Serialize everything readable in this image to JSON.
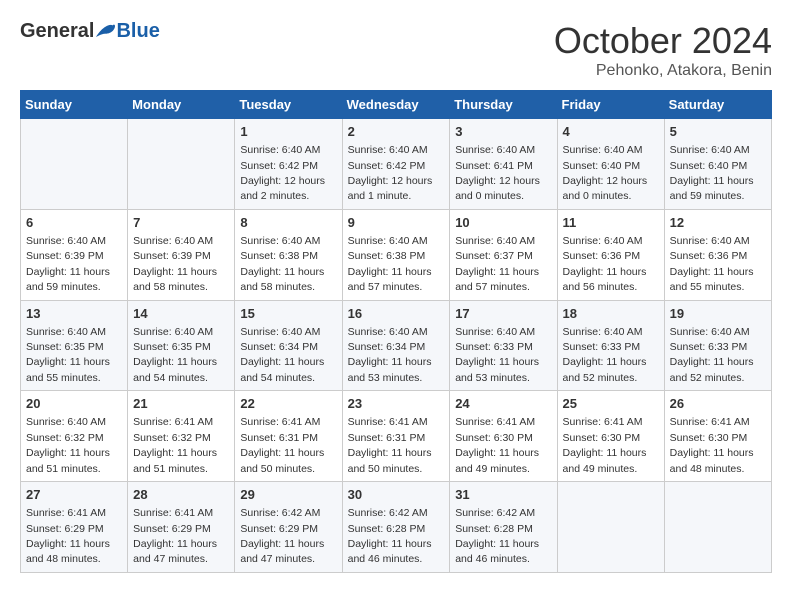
{
  "logo": {
    "general": "General",
    "blue": "Blue"
  },
  "header": {
    "month": "October 2024",
    "location": "Pehonko, Atakora, Benin"
  },
  "days_of_week": [
    "Sunday",
    "Monday",
    "Tuesday",
    "Wednesday",
    "Thursday",
    "Friday",
    "Saturday"
  ],
  "weeks": [
    [
      {
        "day": "",
        "info": ""
      },
      {
        "day": "",
        "info": ""
      },
      {
        "day": "1",
        "info": "Sunrise: 6:40 AM\nSunset: 6:42 PM\nDaylight: 12 hours\nand 2 minutes."
      },
      {
        "day": "2",
        "info": "Sunrise: 6:40 AM\nSunset: 6:42 PM\nDaylight: 12 hours\nand 1 minute."
      },
      {
        "day": "3",
        "info": "Sunrise: 6:40 AM\nSunset: 6:41 PM\nDaylight: 12 hours\nand 0 minutes."
      },
      {
        "day": "4",
        "info": "Sunrise: 6:40 AM\nSunset: 6:40 PM\nDaylight: 12 hours\nand 0 minutes."
      },
      {
        "day": "5",
        "info": "Sunrise: 6:40 AM\nSunset: 6:40 PM\nDaylight: 11 hours\nand 59 minutes."
      }
    ],
    [
      {
        "day": "6",
        "info": "Sunrise: 6:40 AM\nSunset: 6:39 PM\nDaylight: 11 hours\nand 59 minutes."
      },
      {
        "day": "7",
        "info": "Sunrise: 6:40 AM\nSunset: 6:39 PM\nDaylight: 11 hours\nand 58 minutes."
      },
      {
        "day": "8",
        "info": "Sunrise: 6:40 AM\nSunset: 6:38 PM\nDaylight: 11 hours\nand 58 minutes."
      },
      {
        "day": "9",
        "info": "Sunrise: 6:40 AM\nSunset: 6:38 PM\nDaylight: 11 hours\nand 57 minutes."
      },
      {
        "day": "10",
        "info": "Sunrise: 6:40 AM\nSunset: 6:37 PM\nDaylight: 11 hours\nand 57 minutes."
      },
      {
        "day": "11",
        "info": "Sunrise: 6:40 AM\nSunset: 6:36 PM\nDaylight: 11 hours\nand 56 minutes."
      },
      {
        "day": "12",
        "info": "Sunrise: 6:40 AM\nSunset: 6:36 PM\nDaylight: 11 hours\nand 55 minutes."
      }
    ],
    [
      {
        "day": "13",
        "info": "Sunrise: 6:40 AM\nSunset: 6:35 PM\nDaylight: 11 hours\nand 55 minutes."
      },
      {
        "day": "14",
        "info": "Sunrise: 6:40 AM\nSunset: 6:35 PM\nDaylight: 11 hours\nand 54 minutes."
      },
      {
        "day": "15",
        "info": "Sunrise: 6:40 AM\nSunset: 6:34 PM\nDaylight: 11 hours\nand 54 minutes."
      },
      {
        "day": "16",
        "info": "Sunrise: 6:40 AM\nSunset: 6:34 PM\nDaylight: 11 hours\nand 53 minutes."
      },
      {
        "day": "17",
        "info": "Sunrise: 6:40 AM\nSunset: 6:33 PM\nDaylight: 11 hours\nand 53 minutes."
      },
      {
        "day": "18",
        "info": "Sunrise: 6:40 AM\nSunset: 6:33 PM\nDaylight: 11 hours\nand 52 minutes."
      },
      {
        "day": "19",
        "info": "Sunrise: 6:40 AM\nSunset: 6:33 PM\nDaylight: 11 hours\nand 52 minutes."
      }
    ],
    [
      {
        "day": "20",
        "info": "Sunrise: 6:40 AM\nSunset: 6:32 PM\nDaylight: 11 hours\nand 51 minutes."
      },
      {
        "day": "21",
        "info": "Sunrise: 6:41 AM\nSunset: 6:32 PM\nDaylight: 11 hours\nand 51 minutes."
      },
      {
        "day": "22",
        "info": "Sunrise: 6:41 AM\nSunset: 6:31 PM\nDaylight: 11 hours\nand 50 minutes."
      },
      {
        "day": "23",
        "info": "Sunrise: 6:41 AM\nSunset: 6:31 PM\nDaylight: 11 hours\nand 50 minutes."
      },
      {
        "day": "24",
        "info": "Sunrise: 6:41 AM\nSunset: 6:30 PM\nDaylight: 11 hours\nand 49 minutes."
      },
      {
        "day": "25",
        "info": "Sunrise: 6:41 AM\nSunset: 6:30 PM\nDaylight: 11 hours\nand 49 minutes."
      },
      {
        "day": "26",
        "info": "Sunrise: 6:41 AM\nSunset: 6:30 PM\nDaylight: 11 hours\nand 48 minutes."
      }
    ],
    [
      {
        "day": "27",
        "info": "Sunrise: 6:41 AM\nSunset: 6:29 PM\nDaylight: 11 hours\nand 48 minutes."
      },
      {
        "day": "28",
        "info": "Sunrise: 6:41 AM\nSunset: 6:29 PM\nDaylight: 11 hours\nand 47 minutes."
      },
      {
        "day": "29",
        "info": "Sunrise: 6:42 AM\nSunset: 6:29 PM\nDaylight: 11 hours\nand 47 minutes."
      },
      {
        "day": "30",
        "info": "Sunrise: 6:42 AM\nSunset: 6:28 PM\nDaylight: 11 hours\nand 46 minutes."
      },
      {
        "day": "31",
        "info": "Sunrise: 6:42 AM\nSunset: 6:28 PM\nDaylight: 11 hours\nand 46 minutes."
      },
      {
        "day": "",
        "info": ""
      },
      {
        "day": "",
        "info": ""
      }
    ]
  ]
}
